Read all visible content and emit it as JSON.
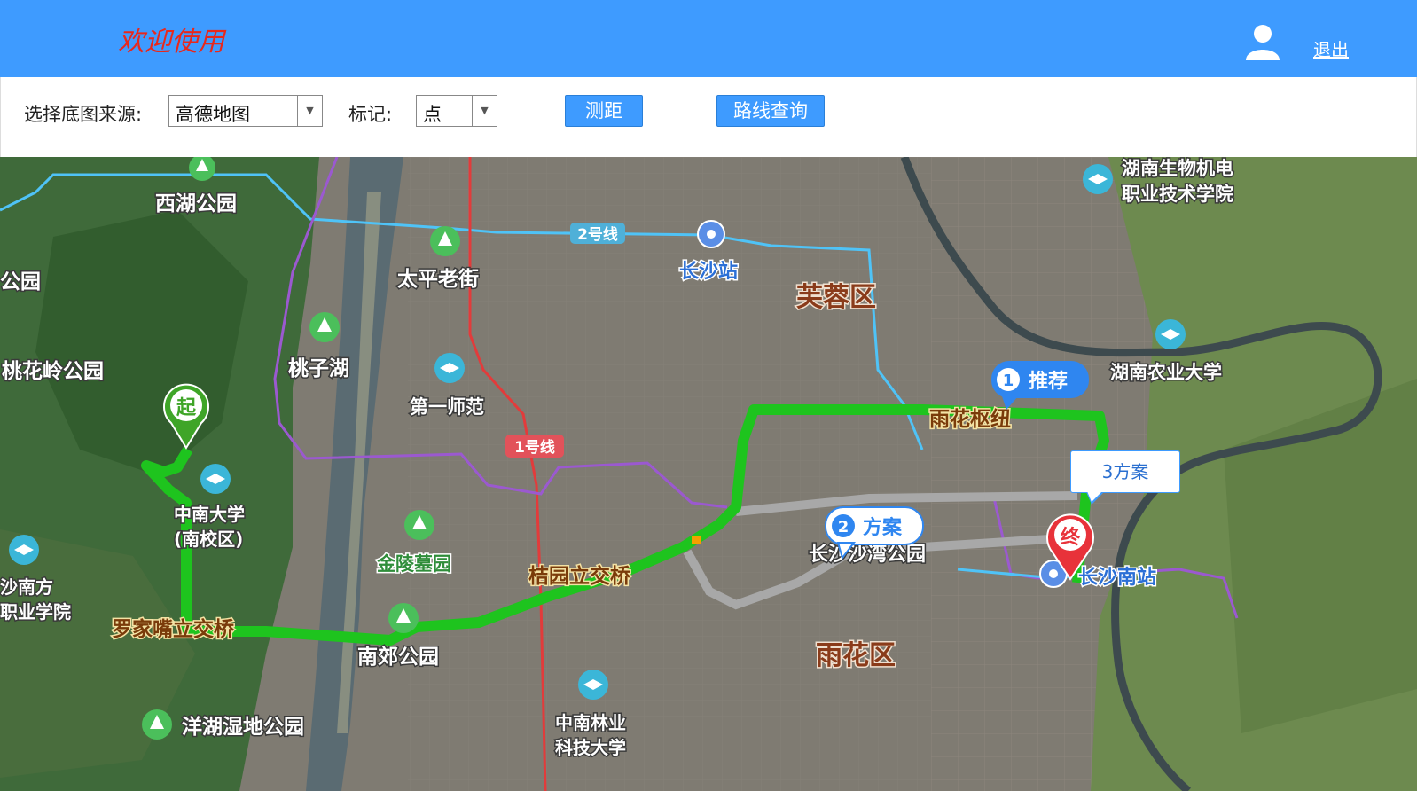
{
  "header": {
    "welcome": "欢迎使用",
    "logout_label": "退出",
    "user_icon": "user-icon"
  },
  "toolbar": {
    "basemap_label": "选择底图来源:",
    "basemap_value": "高德地图",
    "mark_label": "标记:",
    "mark_value": "点",
    "measure_label": "测距",
    "route_label": "路线查询"
  },
  "map": {
    "districts": [
      "芙蓉区",
      "雨花区"
    ],
    "places": {
      "xihu": "西湖公园",
      "taiping": "太平老街",
      "changsha_station": "长沙站",
      "hunan_bio": "湖南生物机电",
      "hunan_bio2": "职业技术学院",
      "park_left": "公园",
      "taoziHu": "桃子湖",
      "taohualing": "桃花岭公园",
      "diyi_shifan": "第一师范",
      "hunan_agri": "湖南农业大学",
      "zhongnan": "中南大学",
      "zhongnan2": "(南校区)",
      "jinling": "金陵墓园",
      "shawan": "长沙沙湾公园",
      "changsha_south_station": "长沙南站",
      "changsha_nanfang": "沙南方",
      "zhiye": "职业学院",
      "nanjiao": "南郊公园",
      "yanghu": "洋湖湿地公园",
      "zhongnan_forestry": "中南林业",
      "zhongnan_forestry2": "科技大学"
    },
    "bridges": {
      "luojiazui": "罗家嘴立交桥",
      "juyuan": "桔园立交桥",
      "yuhua_hub": "雨花枢纽"
    },
    "metro": {
      "line1": "1号线",
      "line2": "2号线"
    },
    "markers": {
      "start": "起",
      "end": "终"
    },
    "plans": {
      "plan1_num": "1",
      "plan1_label": "推荐",
      "plan2_num": "2",
      "plan2_label": "方案",
      "plan3_label": "3方案"
    },
    "colors": {
      "route_recommended": "#1ec41e",
      "route_alt": "#a8a8a8",
      "metro_line1": "#e23b3b",
      "metro_line2": "#4fc3f7",
      "metro_purple": "#9b59d0",
      "header": "#3e9bff"
    }
  }
}
